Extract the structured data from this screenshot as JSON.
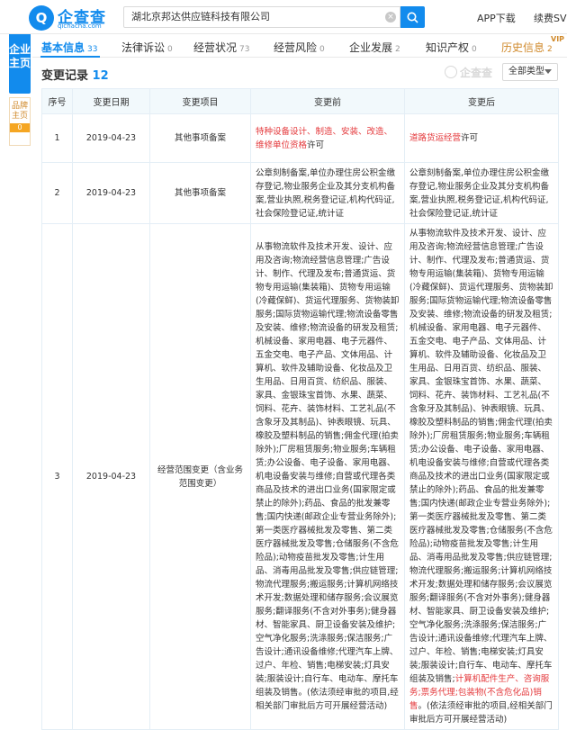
{
  "header": {
    "logo_glyph": "Q",
    "logo_text": "企查查",
    "logo_sub": "qichacha.com",
    "search_value": "湖北京邦达供应链科技有限公司",
    "app_download": "APP下载",
    "vip_renew": "续费SVIP"
  },
  "sidebar": {
    "main_label": "企业主页",
    "brand_label": "品牌主页",
    "brand_count": "0"
  },
  "tabs": [
    {
      "label": "基本信息",
      "count": "33"
    },
    {
      "label": "法律诉讼",
      "count": "0"
    },
    {
      "label": "经营状况",
      "count": "73"
    },
    {
      "label": "经营风险",
      "count": "0"
    },
    {
      "label": "企业发展",
      "count": "2"
    },
    {
      "label": "知识产权",
      "count": "0"
    },
    {
      "label": "历史信息",
      "count": "2"
    }
  ],
  "vip_tag": "VIP",
  "section": {
    "title": "变更记录",
    "count": "12",
    "watermark": "企查查",
    "filter": "全部类型"
  },
  "table": {
    "headers": [
      "序号",
      "变更日期",
      "变更项目",
      "变更前",
      "变更后"
    ],
    "rows": [
      {
        "no": "1",
        "date": "2019-04-23",
        "item": "其他事项备案",
        "before_red": "特种设备设计、制造、安装、改造、维修单位资格",
        "before_tail": "许可",
        "after_red": "道路货运经营",
        "after_tail": "许可"
      },
      {
        "no": "2",
        "date": "2019-04-23",
        "item": "其他事项备案",
        "before": "公章刻制备案,单位办理住房公积金缴存登记,物业服务企业及其分支机构备案,营业执照,税务登记证,机构代码证,社会保险登记证,统计证",
        "after": "公章刻制备案,单位办理住房公积金缴存登记,物业服务企业及其分支机构备案,营业执照,税务登记证,机构代码证,社会保险登记证,统计证"
      },
      {
        "no": "3",
        "date": "2019-04-23",
        "item": "经营范围变更（含业务范围变更）",
        "before": "从事物流软件及技术开发、设计、应用及咨询;物流经营信息管理;广告设计、制作、代理及发布;普通货运、货物专用运输(集装箱)、货物专用运输(冷藏保鲜)、货运代理服务、货物装卸服务;国际货物运输代理;物流设备零售及安装、维修;物流设备的研发及租赁;机械设备、家用电器、电子元器件、五金交电、电子产品、文体用品、计算机、软件及辅助设备、化妆品及卫生用品、日用百货、纺织品、服装、家具、金银珠宝首饰、水果、蔬菜、饲料、花卉、装饰材料、工艺礼品(不含象牙及其制品)、钟表眼镜、玩具、橡胶及塑料制品的销售;佣金代理(拍卖除外);厂房租赁服务;物业服务;车辆租赁;办公设备、电子设备、家用电器、机电设备安装与维修;自营或代理各类商品及技术的进出口业务(国家限定或禁止的除外);药品、食品的批发兼零售;国内快递(邮政企业专营业务除外);第一类医疗器械批发及零售、第二类医疗器械批发及零售;仓储服务(不含危险品);动物疫苗批发及零售;计生用品、消毒用品批发及零售;供应链管理;物流代理服务;搬运服务;计算机网络技术开发;数据处理和储存服务;会议展览服务;翻译服务(不含对外事务);健身器材、智能家具、厨卫设备安装及维护;空气净化服务;洗涤服务;保洁服务;广告设计;通讯设备维修;代理汽车上牌、过户、年检、销售;电梯安装;灯具安装;服装设计;自行车、电动车、摩托车组装及销售。(依法须经审批的项目,经相关部门审批后方可开展经营活动)",
        "after_main": "从事物流软件及技术开发、设计、应用及咨询;物流经营信息管理;广告设计、制作、代理及发布;普通货运、货物专用运输(集装箱)、货物专用运输(冷藏保鲜)、货运代理服务、货物装卸服务;国际货物运输代理;物流设备零售及安装、维修;物流设备的研发及租赁;机械设备、家用电器、电子元器件、五金交电、电子产品、文体用品、计算机、软件及辅助设备、化妆品及卫生用品、日用百货、纺织品、服装、家具、金银珠宝首饰、水果、蔬菜、饲料、花卉、装饰材料、工艺礼品(不含象牙及其制品)、钟表眼镜、玩具、橡胶及塑料制品的销售;佣金代理(拍卖除外);厂房租赁服务;物业服务;车辆租赁;办公设备、电子设备、家用电器、机电设备安装与维修;自营或代理各类商品及技术的进出口业务(国家限定或禁止的除外);药品、食品的批发兼零售;国内快递(邮政企业专营业务除外);第一类医疗器械批发及零售、第二类医疗器械批发及零售;仓储服务(不含危险品);动物疫苗批发及零售;计生用品、消毒用品批发及零售;供应链管理;物流代理服务;搬运服务;计算机网络技术开发;数据处理和储存服务;会议展览服务;翻译服务(不含对外事务);健身器材、智能家具、厨卫设备安装及维护;空气净化服务;洗涤服务;保洁服务;广告设计;通讯设备维修;代理汽车上牌、过户、年检、销售;电梯安装;灯具安装;服装设计;自行车、电动车、摩托车组装及销售;",
        "after_red": "计算机配件生产、咨询服务;票务代理;包装物(不含危化品)销售",
        "after_tail": "。(依法须经审批的项目,经相关部门审批后方可开展经营活动)"
      }
    ]
  }
}
